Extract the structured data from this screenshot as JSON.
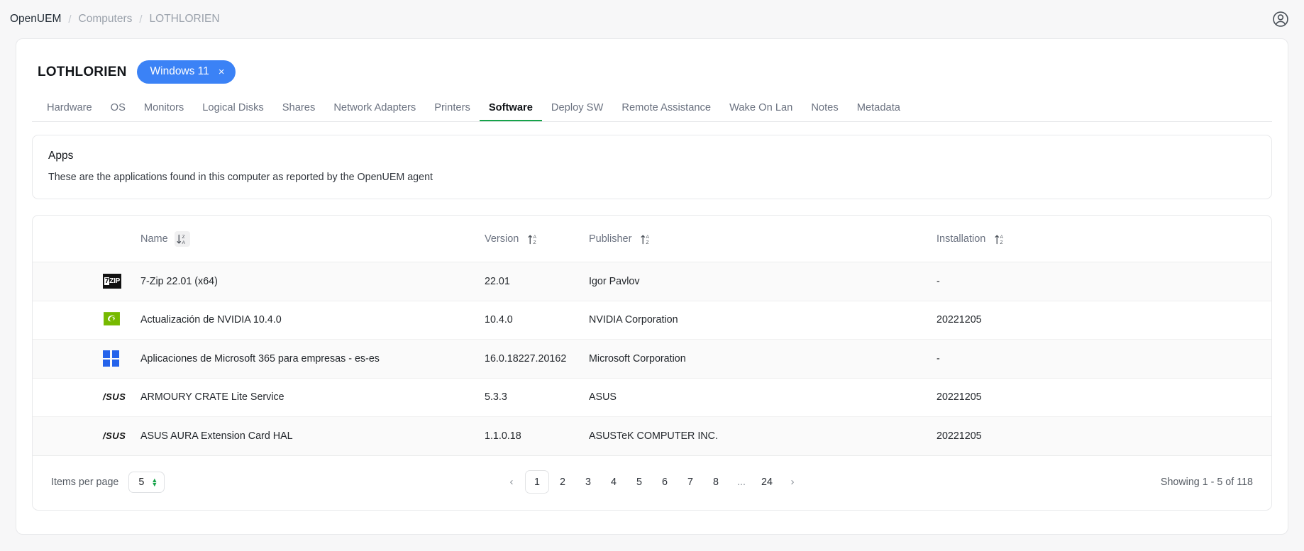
{
  "breadcrumb": {
    "items": [
      {
        "label": "OpenUEM",
        "muted": false
      },
      {
        "label": "Computers",
        "muted": true
      },
      {
        "label": "LOTHLORIEN",
        "muted": true
      }
    ],
    "separator": "/"
  },
  "header": {
    "account_icon": "account-circle-icon"
  },
  "computer": {
    "name": "LOTHLORIEN",
    "os_badge": {
      "label": "Windows 11",
      "close": "×",
      "color": "#3b82f6"
    }
  },
  "tabs": [
    {
      "label": "Hardware",
      "active": false
    },
    {
      "label": "OS",
      "active": false
    },
    {
      "label": "Monitors",
      "active": false
    },
    {
      "label": "Logical Disks",
      "active": false
    },
    {
      "label": "Shares",
      "active": false
    },
    {
      "label": "Network Adapters",
      "active": false
    },
    {
      "label": "Printers",
      "active": false
    },
    {
      "label": "Software",
      "active": true
    },
    {
      "label": "Deploy SW",
      "active": false
    },
    {
      "label": "Remote Assistance",
      "active": false
    },
    {
      "label": "Wake On Lan",
      "active": false
    },
    {
      "label": "Notes",
      "active": false
    },
    {
      "label": "Metadata",
      "active": false
    }
  ],
  "apps_panel": {
    "title": "Apps",
    "description": "These are the applications found in this computer as reported by the OpenUEM agent"
  },
  "table": {
    "columns": [
      {
        "label": "Name",
        "sort": "desc-za",
        "sort_icon": "sort-descending-za-icon",
        "shaded": true
      },
      {
        "label": "Version",
        "sort": "asc-az",
        "sort_icon": "sort-ascending-az-icon",
        "shaded": false
      },
      {
        "label": "Publisher",
        "sort": "asc-az",
        "sort_icon": "sort-ascending-az-icon",
        "shaded": false
      },
      {
        "label": "Installation",
        "sort": "asc-az",
        "sort_icon": "sort-ascending-az-icon",
        "shaded": false
      }
    ],
    "rows": [
      {
        "icon": "seven-zip-icon",
        "name": "7-Zip 22.01 (x64)",
        "version": "22.01",
        "publisher": "Igor Pavlov",
        "installation": "-"
      },
      {
        "icon": "nvidia-icon",
        "name": "Actualización de NVIDIA 10.4.0",
        "version": "10.4.0",
        "publisher": "NVIDIA Corporation",
        "installation": "20221205"
      },
      {
        "icon": "microsoft-icon",
        "name": "Aplicaciones de Microsoft 365 para empresas - es-es",
        "version": "16.0.18227.20162",
        "publisher": "Microsoft Corporation",
        "installation": "-"
      },
      {
        "icon": "asus-icon",
        "name": "ARMOURY CRATE Lite Service",
        "version": "5.3.3",
        "publisher": "ASUS",
        "installation": "20221205"
      },
      {
        "icon": "asus-icon",
        "name": "ASUS AURA Extension Card HAL",
        "version": "1.1.0.18",
        "publisher": "ASUSTeK COMPUTER INC.",
        "installation": "20221205"
      }
    ]
  },
  "pagination": {
    "items_per_page_label": "Items per page",
    "items_per_page_value": "5",
    "prev": "‹",
    "next": "›",
    "pages": [
      "1",
      "2",
      "3",
      "4",
      "5",
      "6",
      "7",
      "8",
      "...",
      "24"
    ],
    "current_page": "1",
    "showing": "Showing 1 - 5 of 118"
  }
}
